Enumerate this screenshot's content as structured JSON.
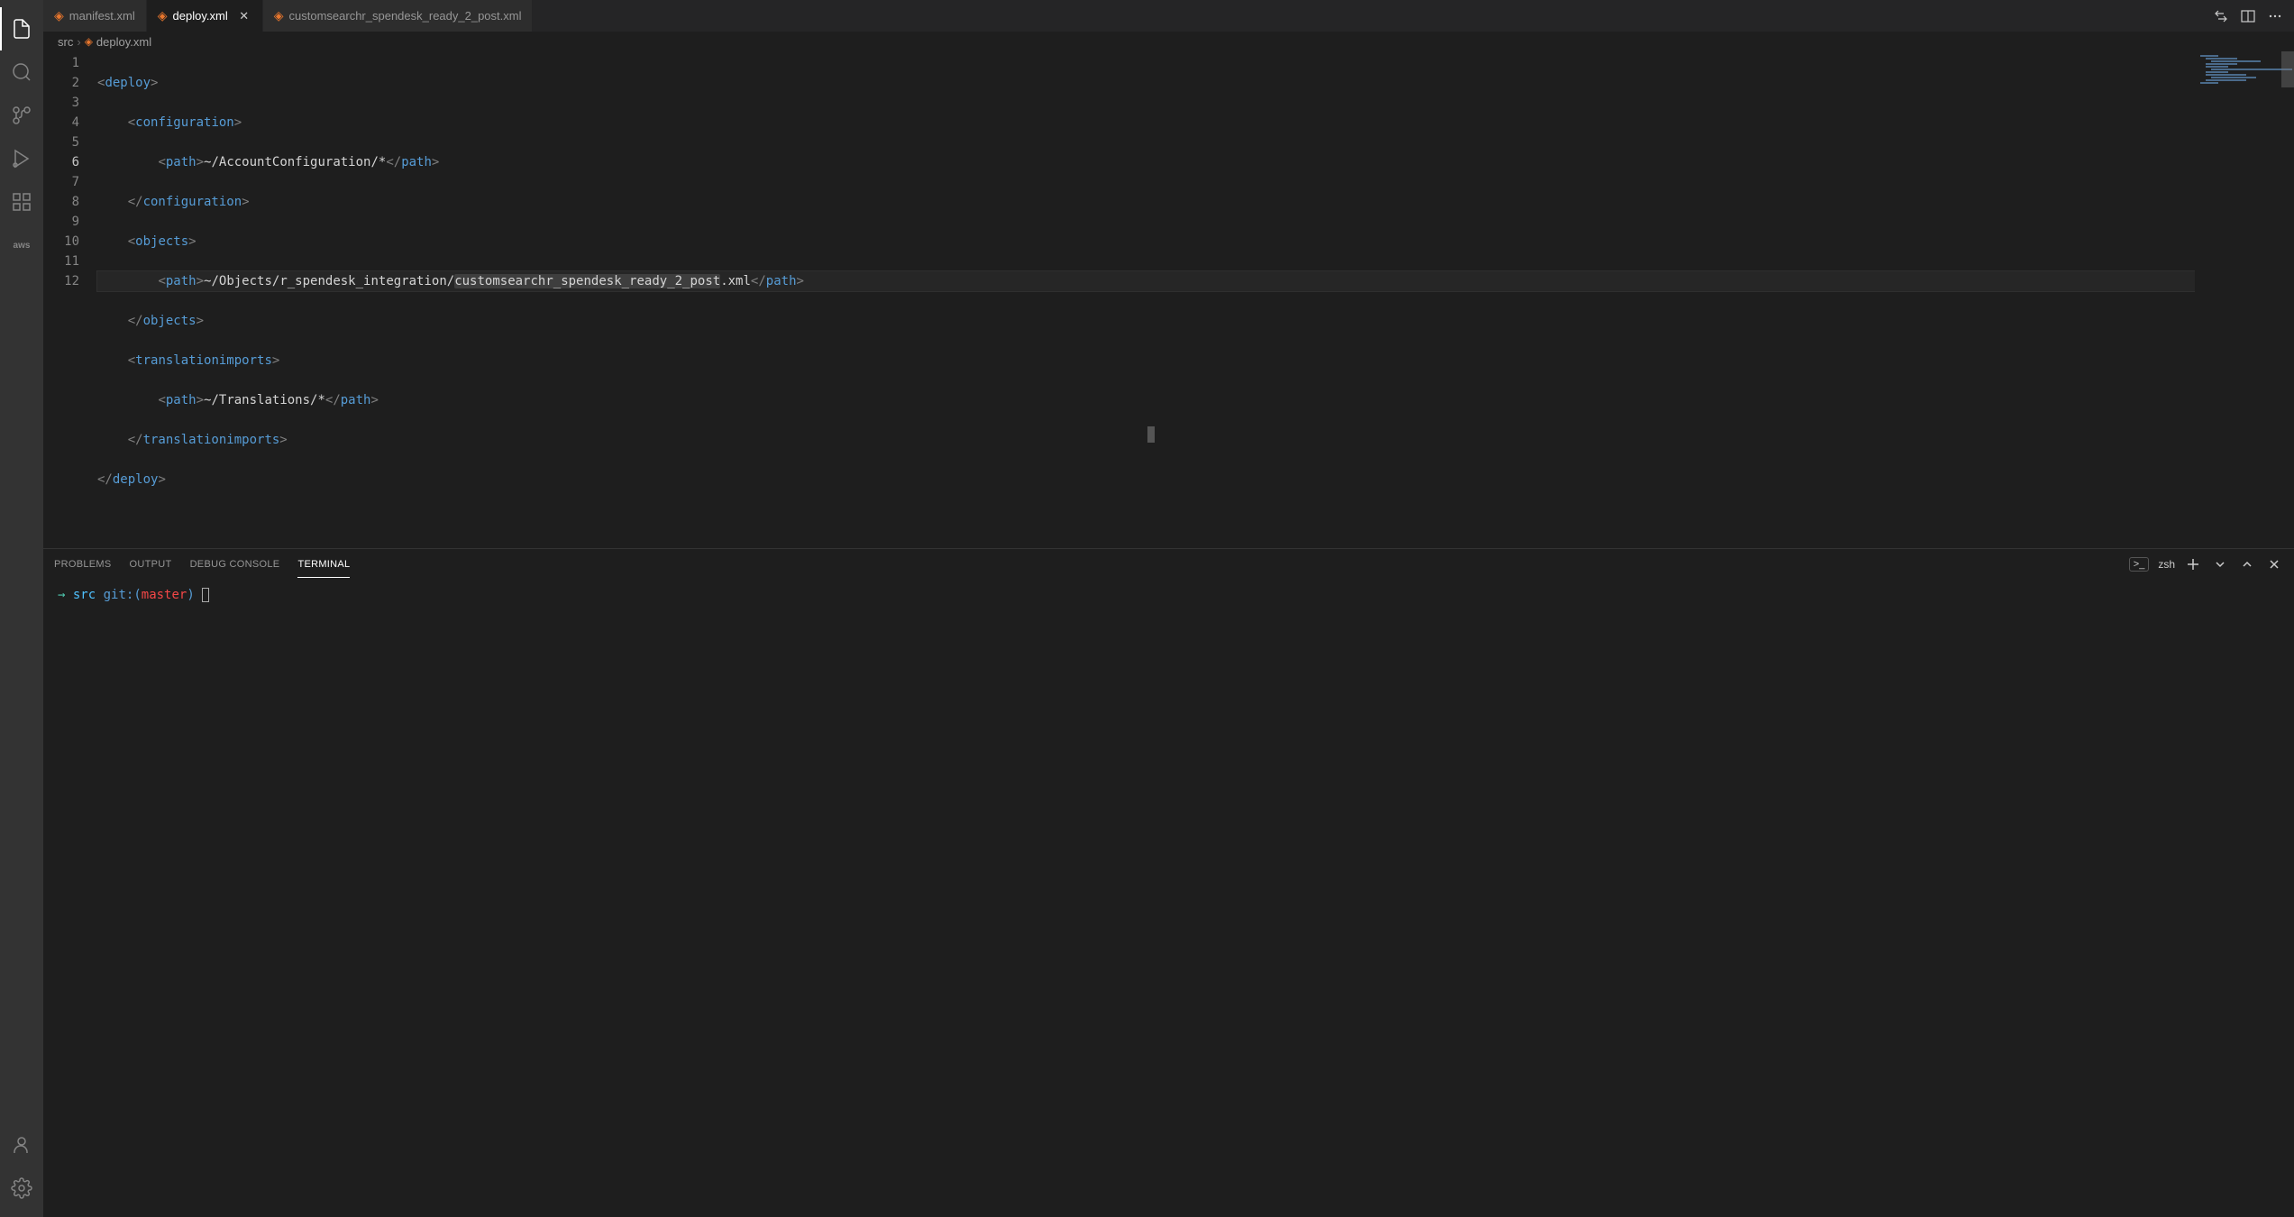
{
  "tabs": [
    {
      "label": "manifest.xml",
      "active": false,
      "close_visible": false
    },
    {
      "label": "deploy.xml",
      "active": true,
      "close_visible": true
    },
    {
      "label": "customsearchr_spendesk_ready_2_post.xml",
      "active": false,
      "close_visible": false
    }
  ],
  "breadcrumbs": {
    "part1": "src",
    "part2": "deploy.xml"
  },
  "editor": {
    "line_numbers": [
      "1",
      "2",
      "3",
      "4",
      "5",
      "6",
      "7",
      "8",
      "9",
      "10",
      "11",
      "12"
    ],
    "lines": {
      "l1": {
        "open": "<",
        "tag": "deploy",
        "close": ">"
      },
      "l2": {
        "open": "<",
        "tag": "configuration",
        "close": ">"
      },
      "l3": {
        "open": "<",
        "tag": "path",
        "close": ">",
        "text": "~/AccountConfiguration/*",
        "copen": "</",
        "ctag": "path",
        "cclose": ">"
      },
      "l4": {
        "open": "</",
        "tag": "configuration",
        "close": ">"
      },
      "l5": {
        "open": "<",
        "tag": "objects",
        "close": ">"
      },
      "l6": {
        "open": "<",
        "tag": "path",
        "close": ">",
        "text_a": "~/Objects/r_spendesk_integration/",
        "text_hl": "customsearchr_spendesk_ready_2_post",
        "text_b": ".xml",
        "copen": "</",
        "ctag": "path",
        "cclose": ">"
      },
      "l7": {
        "open": "</",
        "tag": "objects",
        "close": ">"
      },
      "l8": {
        "open": "<",
        "tag": "translationimports",
        "close": ">"
      },
      "l9": {
        "open": "<",
        "tag": "path",
        "close": ">",
        "text": "~/Translations/*",
        "copen": "</",
        "ctag": "path",
        "cclose": ">"
      },
      "l10": {
        "open": "</",
        "tag": "translationimports",
        "close": ">"
      },
      "l11": {
        "open": "</",
        "tag": "deploy",
        "close": ">"
      }
    }
  },
  "panel": {
    "tabs": {
      "problems": "PROBLEMS",
      "output": "OUTPUT",
      "debug": "DEBUG CONSOLE",
      "terminal": "TERMINAL"
    },
    "shell": "zsh"
  },
  "terminal": {
    "arrow": "→",
    "path": "src",
    "git_label": "git:(",
    "branch": "master",
    "git_close": ")"
  },
  "activity": {
    "aws": "aws"
  }
}
